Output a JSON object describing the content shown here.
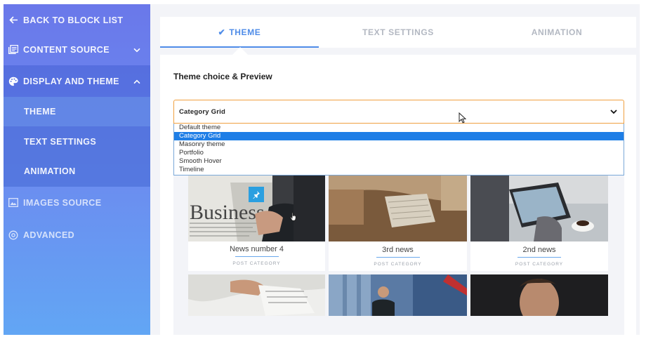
{
  "sidebar": {
    "back": "BACK TO BLOCK LIST",
    "content_source": "CONTENT SOURCE",
    "display_theme": "DISPLAY AND THEME",
    "sub": [
      "THEME",
      "TEXT SETTINGS",
      "ANIMATION"
    ],
    "images_source": "IMAGES SOURCE",
    "advanced": "ADVANCED"
  },
  "tabs": {
    "check": "✔",
    "theme": "THEME",
    "text_settings": "TEXT SETTINGS",
    "animation": "ANIMATION"
  },
  "panel": {
    "title": "Theme choice & Preview",
    "select_value": "Category Grid",
    "options": [
      "Default theme",
      "Category Grid",
      "Masonry theme",
      "Portfolio",
      "Smooth Hover",
      "Timeline"
    ]
  },
  "cards": [
    {
      "title": "News number 4",
      "category": "POST CATEGORY"
    },
    {
      "title": "3rd news",
      "category": "POST CATEGORY"
    },
    {
      "title": "2nd news",
      "category": "POST CATEGORY"
    }
  ],
  "image_text": {
    "business": "Business"
  },
  "colors": {
    "accent": "#4f8ce8",
    "select_border": "#f0a040",
    "selected_option": "#1e7ee6",
    "pin": "#2a9fe0"
  },
  "icons": [
    "arrow-left-icon",
    "content-source-icon",
    "palette-icon",
    "images-icon",
    "settings-circle-icon",
    "chevron-down-icon",
    "chevron-up-icon",
    "check-icon",
    "pin-icon",
    "mouse-cursor-icon",
    "hand-cursor-icon"
  ]
}
